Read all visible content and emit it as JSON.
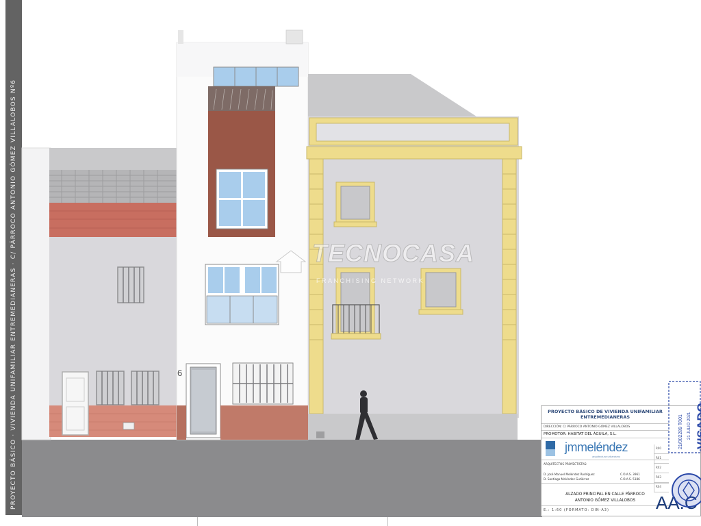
{
  "side_strip": {
    "text": "PROYECTO BÁSICO · VIVIENDA UNIFAMILIAR ENTREMEDIANERAS · C/ PÁRROCO ANTONIO GÓMEZ VILLALOBOS Nº6"
  },
  "drawing": {
    "house_number": "6",
    "colors": {
      "facade_white": "#fbfbfb",
      "render_grey": "#d9d8dc",
      "roof_grey": "#c9c9cb",
      "brick": "#c86e60",
      "plinth_brick": "#d68a7a",
      "terracotta_panel": "#9a5747",
      "yellow_trim": "#eedc8c",
      "window_glass": "#a9cdec",
      "street": "#8b8b8d"
    }
  },
  "watermark": {
    "brand": "TECNOCASA",
    "subtitle": "FRANCHISING NETWORK",
    "icon": "house-icon"
  },
  "title_block": {
    "project_line_1": "PROYECTO BÁSICO DE VIVIENDA UNIFAMILIAR",
    "project_line_2": "ENTREMEDIANERAS",
    "address": "DIRECCIÓN: C/ PÁRROCO ANTONIO GÓMEZ VILLALOBOS",
    "promoter": "PROMOTOR: HABITAT DEL ÁGUILA, S.L.",
    "brand_name": "jmmeléndez",
    "brand_sub": "arquitectura·urbanismo",
    "architects_heading": "ARQUITECTOS PROYECTISTAS:",
    "architect_1": "D. José Manuel Meléndez Rodríguez",
    "architect_1_reg": "C.O.A.S. 3961",
    "architect_2": "D. Santiago Meléndez Gutiérrez",
    "architect_2_reg": "C.O.A.S. 5186",
    "sheet_title_1": "ALZADO PRINCIPAL EN CALLE PÁRROCO",
    "sheet_title_2": "ANTONIO GÓMEZ VILLALOBOS",
    "scale": "E.: 1:60 (FORMATO: DIN-A3)",
    "sheet_code": "AA.C",
    "revisions": [
      "R00",
      "R01",
      "R02",
      "R03",
      "R04"
    ],
    "visado_stamp": "VISADO",
    "visado_number": "21/002289 T001",
    "visado_date": "21 JULIO 2021"
  }
}
